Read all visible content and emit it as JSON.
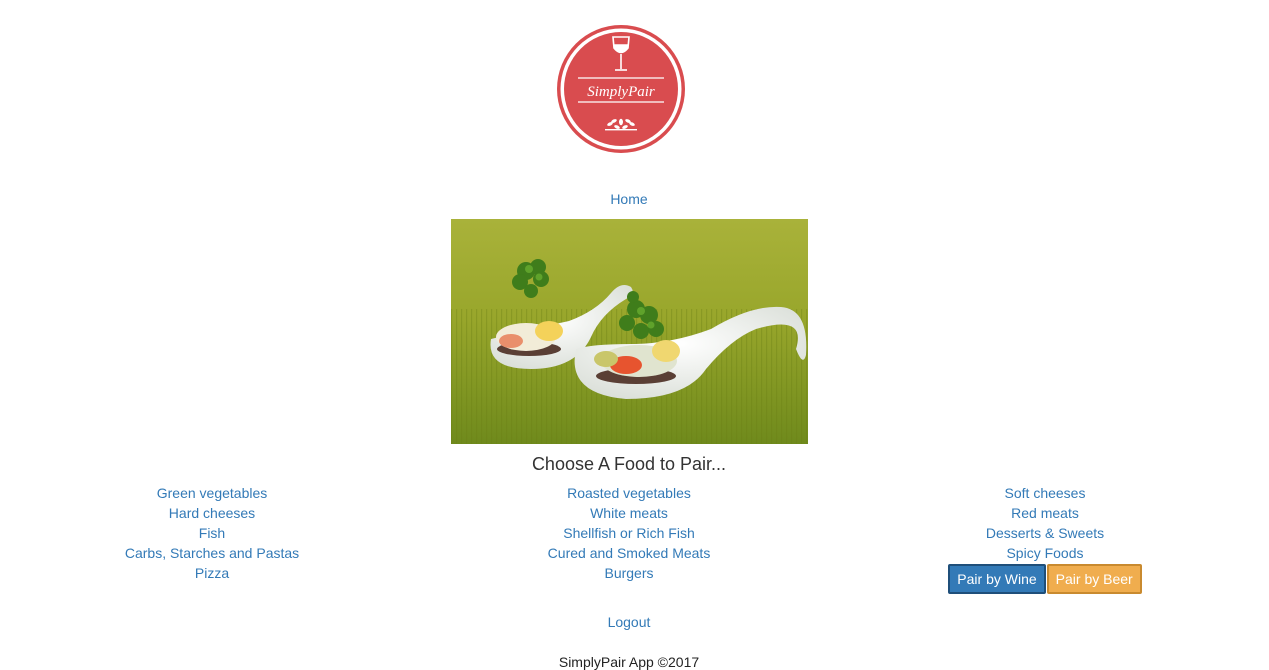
{
  "logo": {
    "text": "SimplyPair",
    "brand_color": "#d94c4f",
    "icon": "wine-glass-icon",
    "ornament": "wheat-ornament-icon"
  },
  "nav": {
    "home_label": "Home"
  },
  "hero": {
    "image": "food-appetizer-spoons-image"
  },
  "heading": "Choose A Food to Pair...",
  "columns": {
    "left": [
      "Green vegetables",
      "Hard cheeses",
      "Fish",
      "Carbs, Starches and Pastas",
      "Pizza"
    ],
    "middle": [
      "Roasted vegetables",
      "White meats",
      "Shellfish or Rich Fish",
      "Cured and Smoked Meats",
      "Burgers"
    ],
    "right": [
      "Soft cheeses",
      "Red meats",
      "Desserts & Sweets",
      "Spicy Foods"
    ]
  },
  "buttons": {
    "wine_label": "Pair by Wine",
    "beer_label": "Pair by Beer",
    "wine_color": "#337ab7",
    "beer_color": "#f0ad4e"
  },
  "logout_label": "Logout",
  "footer": "SimplyPair App ©2017",
  "colors": {
    "link": "#337ab7",
    "text": "#333333"
  }
}
